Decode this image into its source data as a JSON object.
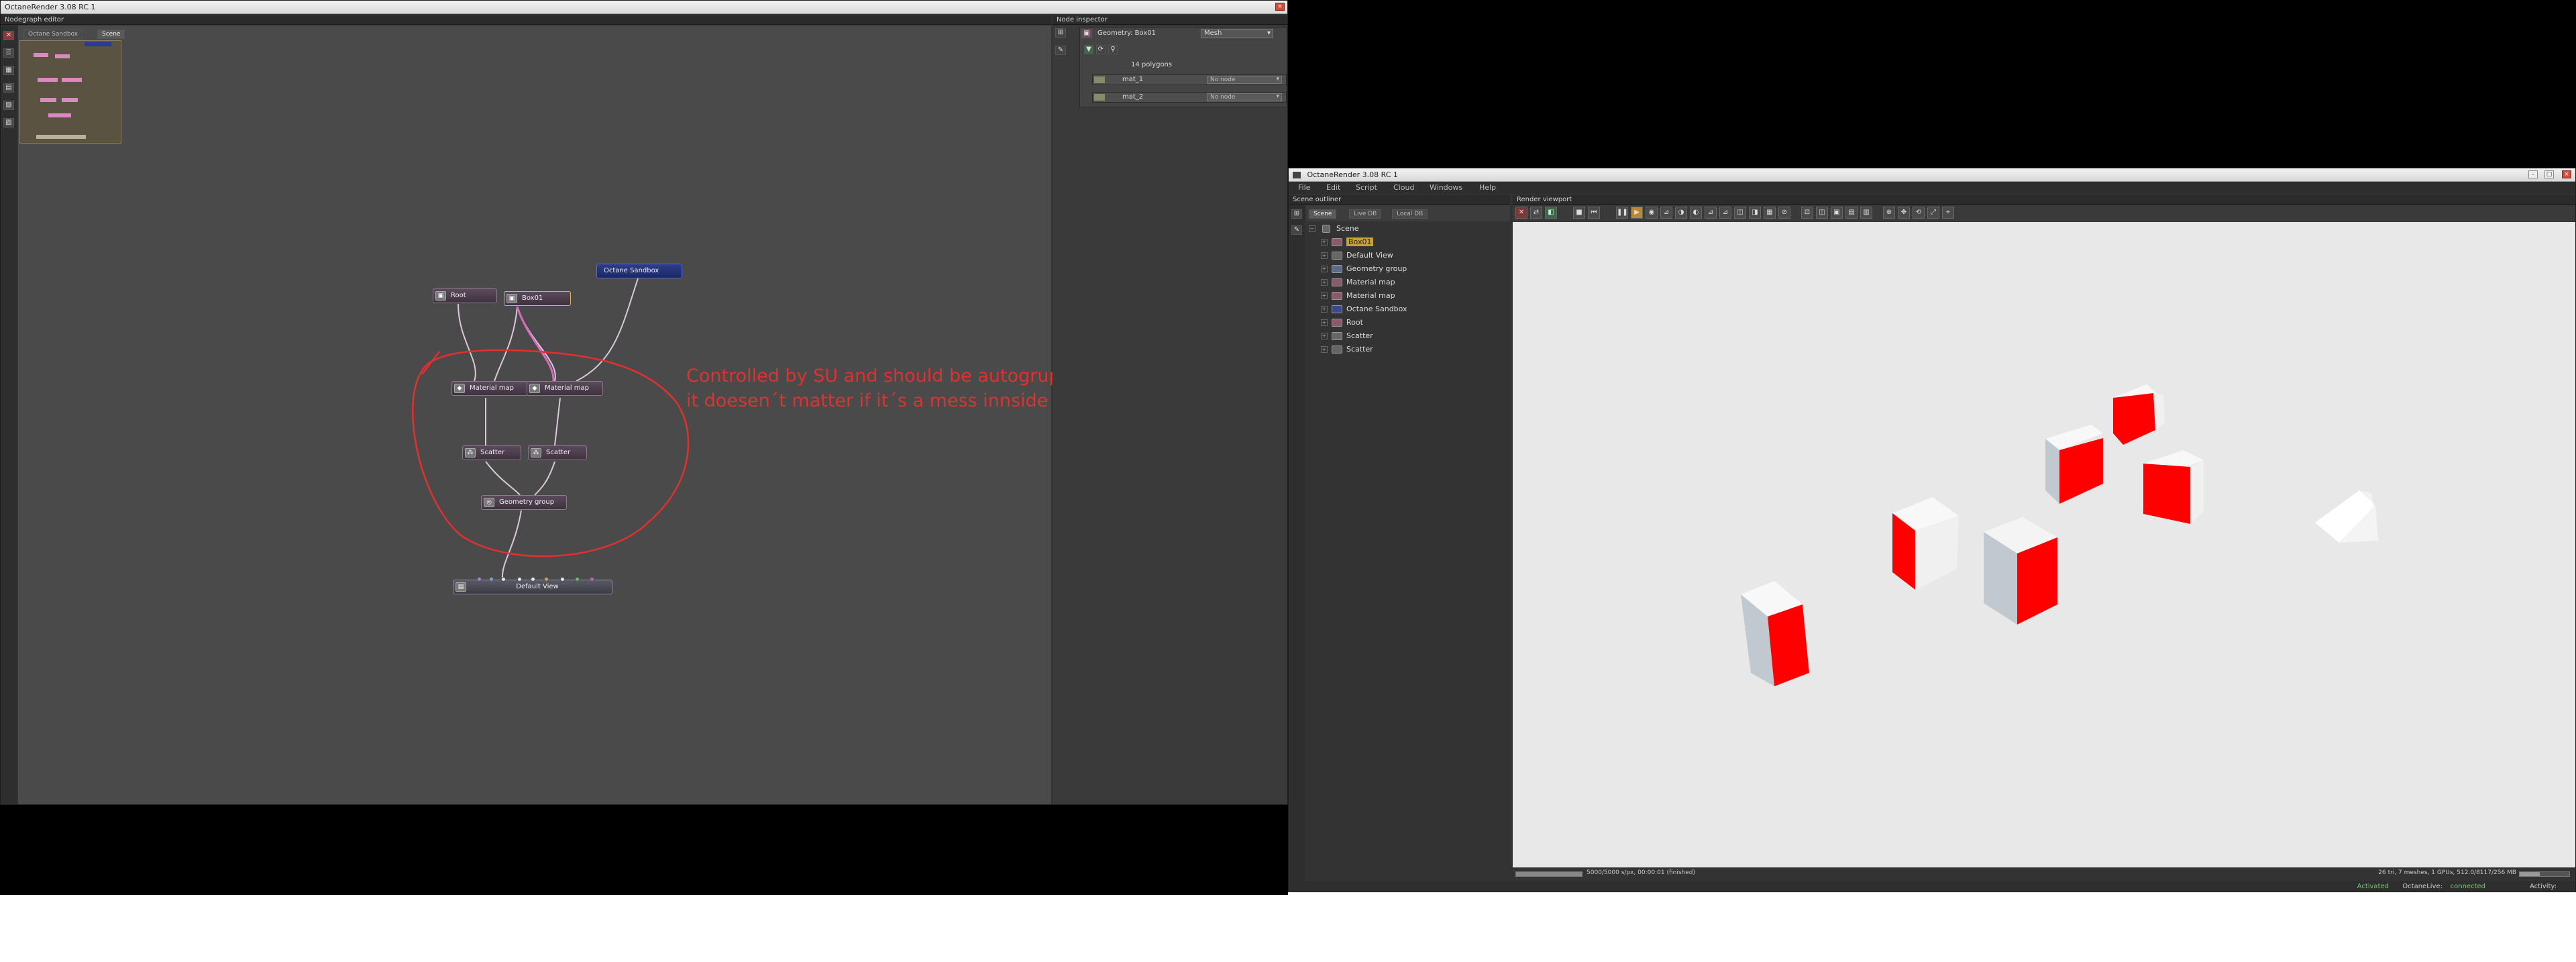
{
  "left_window": {
    "title": "OctaneRender 3.08 RC 1",
    "nodegraph": {
      "header": "Nodegraph editor",
      "tabs": [
        "Octane Sandbox",
        "Scene"
      ],
      "nodes": {
        "root": "Root",
        "box": "Box01",
        "sandbox": "Octane Sandbox",
        "matmap1": "Material map",
        "matmap2": "Material map",
        "scatter1": "Scatter",
        "scatter2": "Scatter",
        "geogroup": "Geometry group",
        "defaultview": "Default View"
      },
      "annotation_line1": "Controlled by SU and should be autogruped. Then",
      "annotation_line2": "it doesen´t matter if it´s a mess innside this group.",
      "annotation_color": "#e03030"
    },
    "inspector": {
      "header": "Node inspector",
      "geometry_label": "Geometry: Box01",
      "type_value": "Mesh",
      "polygons": "14 polygons",
      "slots": [
        {
          "name": "mat_1",
          "value": "No node"
        },
        {
          "name": "mat_2",
          "value": "No node"
        }
      ]
    }
  },
  "right_window": {
    "title": "OctaneRender 3.08 RC 1",
    "menu": [
      "File",
      "Edit",
      "Script",
      "Cloud",
      "Windows",
      "Help"
    ],
    "outliner": {
      "header": "Scene outliner",
      "tabs": [
        "Scene",
        "Live DB",
        "Local DB"
      ],
      "root": "Scene",
      "items": [
        "Box01",
        "Default View",
        "Geometry group",
        "Material map",
        "Material map",
        "Octane Sandbox",
        "Root",
        "Scatter",
        "Scatter"
      ]
    },
    "viewport": {
      "header": "Render viewport",
      "status_left": "5000/5000 s/px, 00:00:01 (finished)",
      "status_right": "26 tri, 7 meshes, 1 GPUs, 512.0/8117/256 MB",
      "cube_color": "#ff0000"
    },
    "statusbar": {
      "activated": "Activated",
      "octanelive_label": "OctaneLive:",
      "octanelive_value": "connected",
      "activity": "Activity:"
    }
  }
}
